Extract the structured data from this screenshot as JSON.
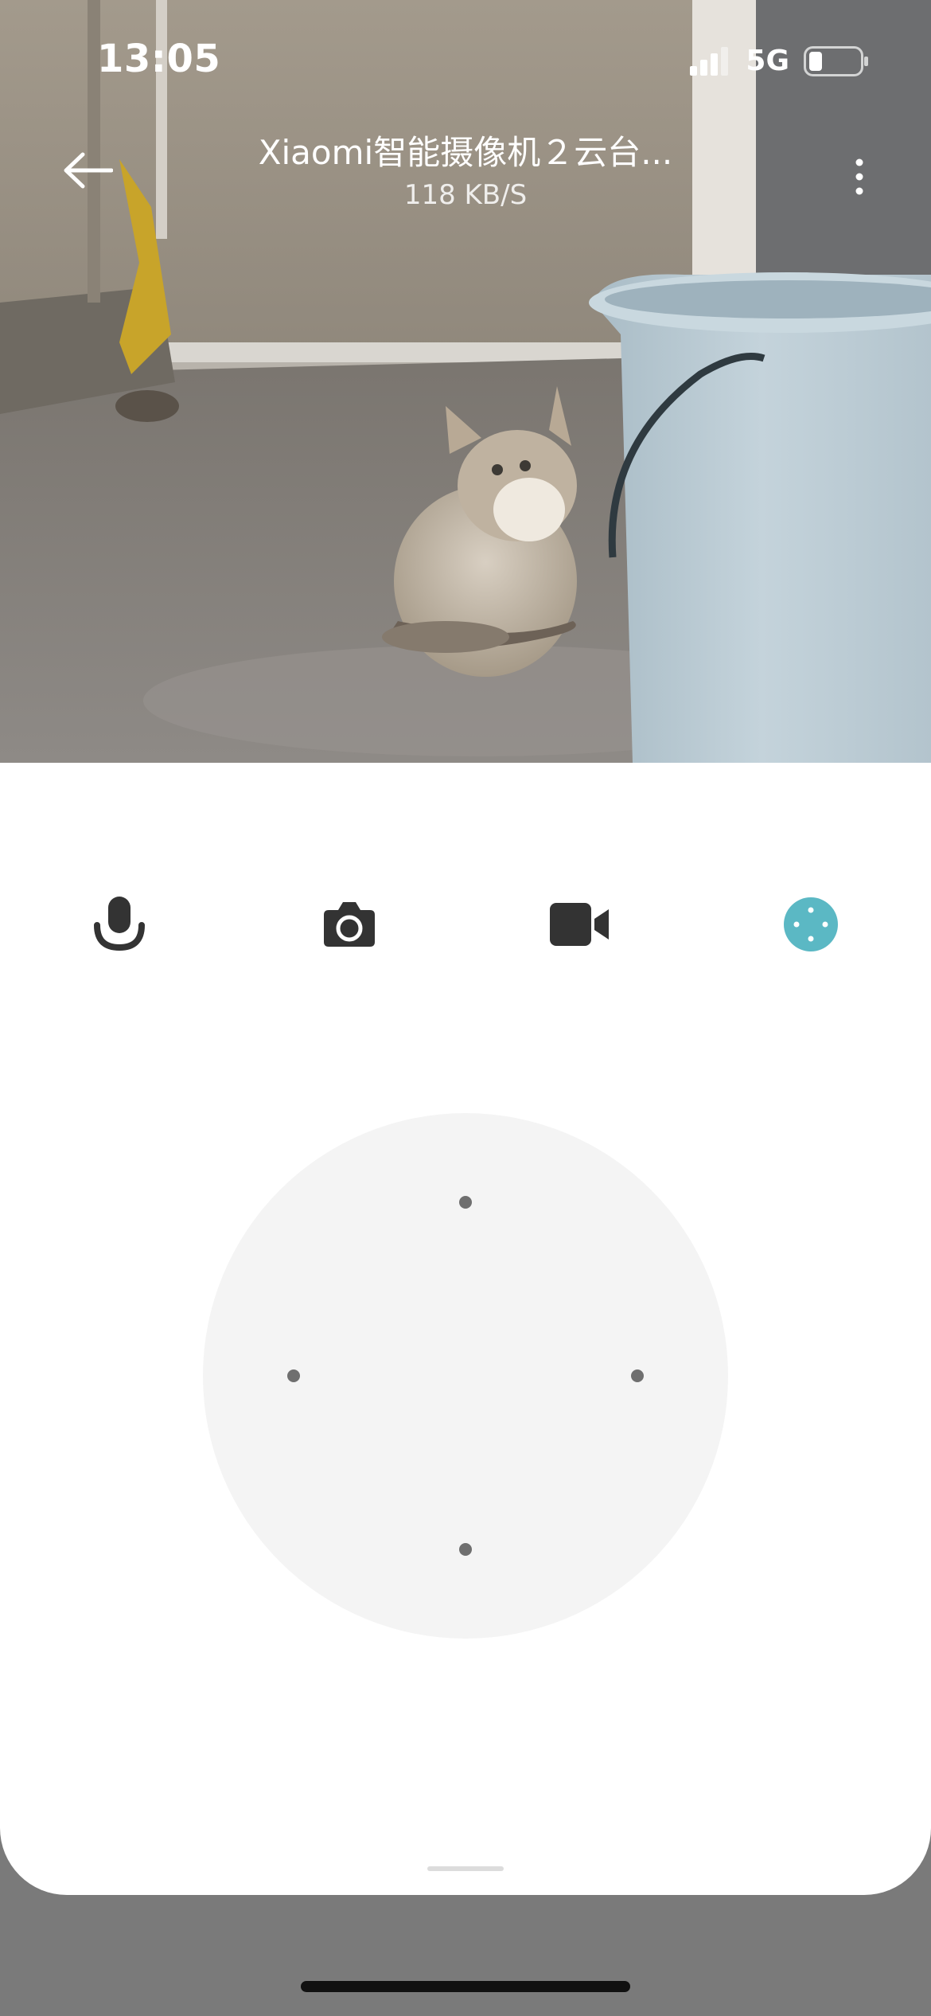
{
  "status_bar": {
    "time": "13:05",
    "network": "5G",
    "signal_icon": "signal-bars-icon",
    "battery_icon": "battery-icon"
  },
  "header": {
    "title": "Xiaomi智能摄像机２云台...",
    "bitrate": "118 KB/S",
    "back_icon": "back-arrow-icon",
    "more_icon": "more-vertical-icon"
  },
  "toolbar": {
    "items": [
      {
        "name": "talk",
        "icon": "microphone-icon"
      },
      {
        "name": "snapshot",
        "icon": "camera-icon"
      },
      {
        "name": "record",
        "icon": "video-camera-icon"
      },
      {
        "name": "pan-tilt",
        "icon": "direction-pad-icon",
        "active": true
      }
    ]
  },
  "colors": {
    "accent": "#5bb8c4",
    "icon": "#333333",
    "dpad_bg": "#f4f4f4",
    "dpad_dot": "#6f6f6f"
  }
}
